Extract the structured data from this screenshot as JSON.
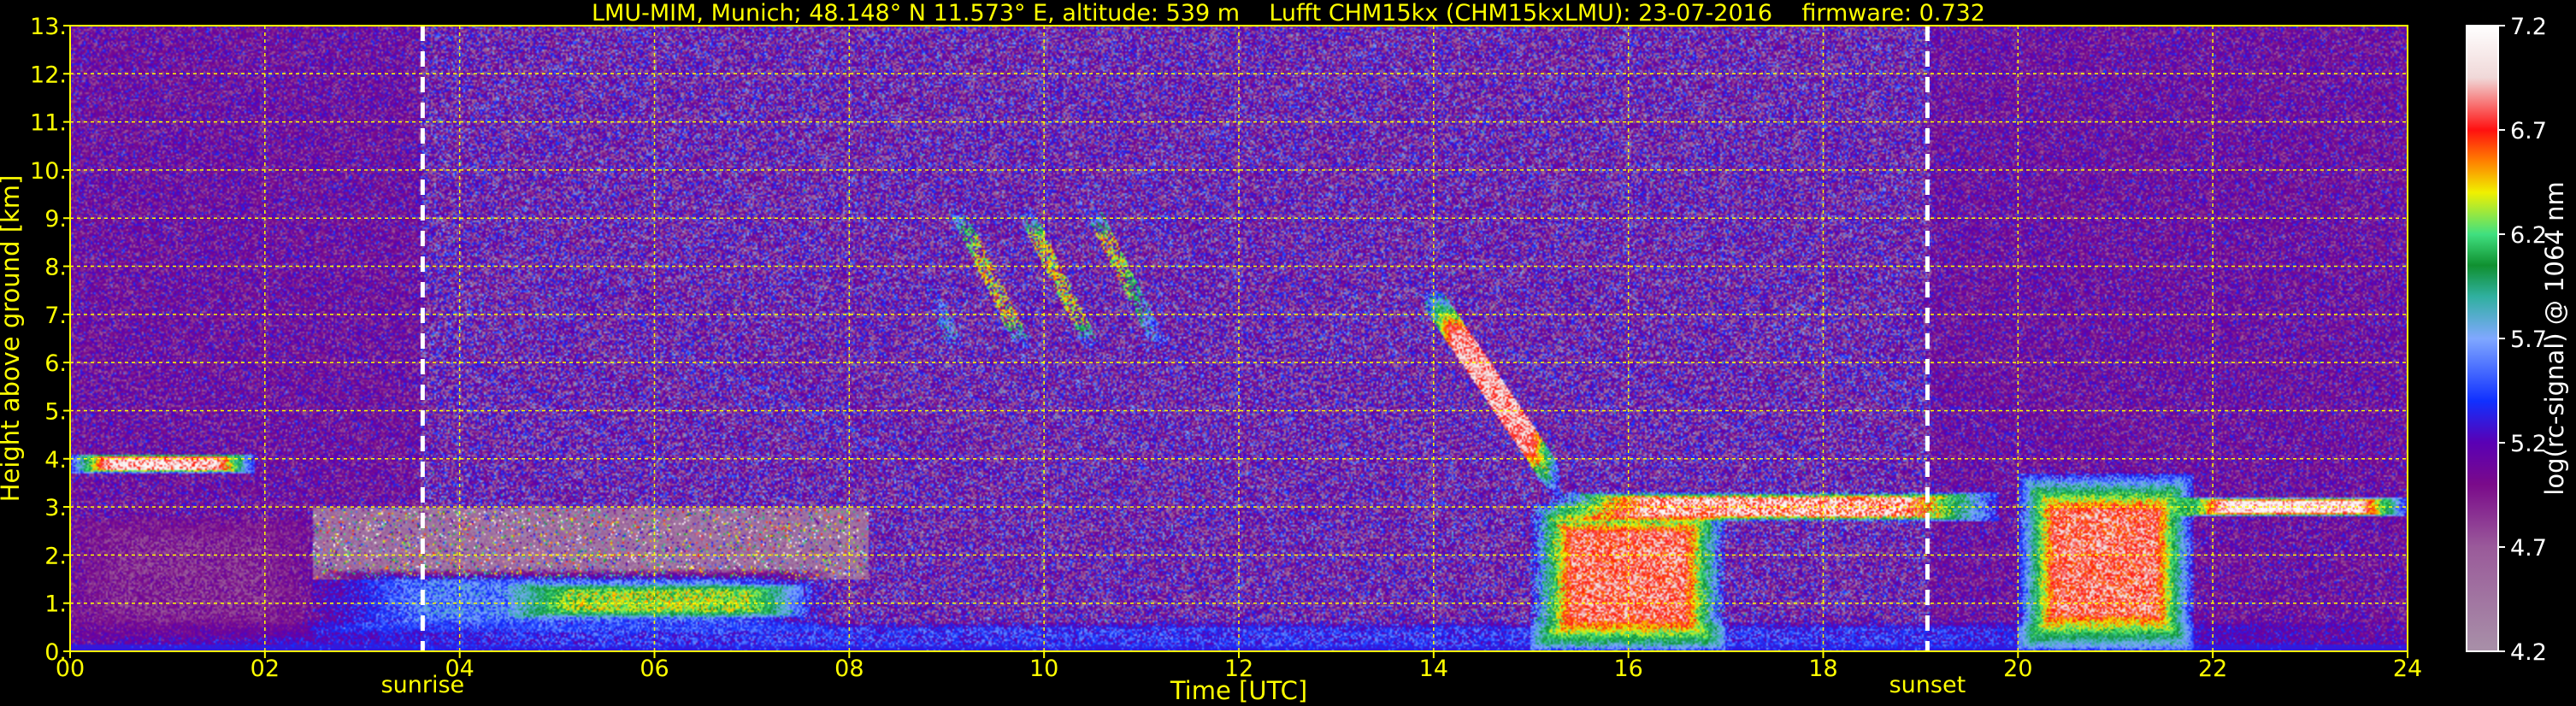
{
  "chart_data": {
    "type": "heatmap",
    "title": "LMU-MIM, Munich; 48.148° N 11.573° E, altitude: 539 m    Lufft CHM15kx (CHM15kxLMU): 23-07-2016    firmware: 0.732",
    "xlabel": "Time [UTC]",
    "ylabel": "Height above ground [km]",
    "xlim": [
      0,
      24
    ],
    "ylim": [
      0,
      13
    ],
    "x_ticks": [
      "00",
      "02",
      "04",
      "06",
      "08",
      "10",
      "12",
      "14",
      "16",
      "18",
      "20",
      "22",
      "24"
    ],
    "x_tick_values": [
      0,
      2,
      4,
      6,
      8,
      10,
      12,
      14,
      16,
      18,
      20,
      22,
      24
    ],
    "y_ticks": [
      "0.",
      "1.",
      "2.",
      "3.",
      "4.",
      "5.",
      "6.",
      "7.",
      "8.",
      "9.",
      "10.",
      "11.",
      "12.",
      "13."
    ],
    "y_tick_values": [
      0,
      1,
      2,
      3,
      4,
      5,
      6,
      7,
      8,
      9,
      10,
      11,
      12,
      13
    ],
    "grid": true,
    "events": [
      {
        "label": "sunrise",
        "time": 3.62
      },
      {
        "label": "sunset",
        "time": 19.07
      }
    ],
    "colorbar": {
      "label": "log(rc-signal) @ 1064 nm",
      "range": [
        4.2,
        7.2
      ],
      "ticks": [
        "4.2",
        "4.7",
        "5.2",
        "5.7",
        "6.2",
        "6.7",
        "7.2"
      ],
      "tick_values": [
        4.2,
        4.7,
        5.2,
        5.7,
        6.2,
        6.7,
        7.2
      ],
      "stops": [
        {
          "v": 4.2,
          "color": "#a890a8"
        },
        {
          "v": 4.7,
          "color": "#9a5a9a"
        },
        {
          "v": 5.0,
          "color": "#7a0a8a"
        },
        {
          "v": 5.2,
          "color": "#5a00b4"
        },
        {
          "v": 5.4,
          "color": "#1030ff"
        },
        {
          "v": 5.7,
          "color": "#80a8ff"
        },
        {
          "v": 5.9,
          "color": "#30b0a0"
        },
        {
          "v": 6.05,
          "color": "#109030"
        },
        {
          "v": 6.2,
          "color": "#40e080"
        },
        {
          "v": 6.4,
          "color": "#f0f000"
        },
        {
          "v": 6.55,
          "color": "#ff8000"
        },
        {
          "v": 6.7,
          "color": "#ff1010"
        },
        {
          "v": 6.95,
          "color": "#f0d8d8"
        },
        {
          "v": 7.2,
          "color": "#ffffff"
        }
      ]
    },
    "features": [
      {
        "name": "boundary layer aerosol",
        "t": [
          0,
          24
        ],
        "h": [
          0,
          0.6
        ],
        "v": 5.4
      },
      {
        "name": "residual layer",
        "t": [
          0,
          2.5
        ],
        "h": [
          0.3,
          2.8
        ],
        "v": 4.9
      },
      {
        "name": "cloud layer",
        "t": [
          0,
          1.9
        ],
        "h": [
          3.7,
          4.1
        ],
        "v": 6.9
      },
      {
        "name": "morning aerosol layer",
        "t": [
          2.5,
          7.8
        ],
        "h": [
          0.4,
          1.7
        ],
        "v": 5.6
      },
      {
        "name": "morning aerosol core",
        "t": [
          4.5,
          7.6
        ],
        "h": [
          0.7,
          1.4
        ],
        "v": 6.3
      },
      {
        "name": "cirrus",
        "t": [
          8.8,
          11.3
        ],
        "h": [
          6.3,
          9.2
        ],
        "v": 6.4
      },
      {
        "name": "descending cloud",
        "t": [
          13.9,
          15.3
        ],
        "h": [
          3.3,
          7.5
        ],
        "v": 6.9
      },
      {
        "name": "rain",
        "t": [
          15.0,
          17.0
        ],
        "h": [
          0,
          3.1
        ],
        "v": 6.8
      },
      {
        "name": "cloud base",
        "t": [
          15.2,
          19.8
        ],
        "h": [
          2.7,
          3.3
        ],
        "v": 6.8
      },
      {
        "name": "evening rain",
        "t": [
          20.0,
          21.8
        ],
        "h": [
          0,
          3.7
        ],
        "v": 6.8
      },
      {
        "name": "evening cloud base",
        "t": [
          21.6,
          24
        ],
        "h": [
          2.8,
          3.2
        ],
        "v": 7.0
      }
    ]
  }
}
